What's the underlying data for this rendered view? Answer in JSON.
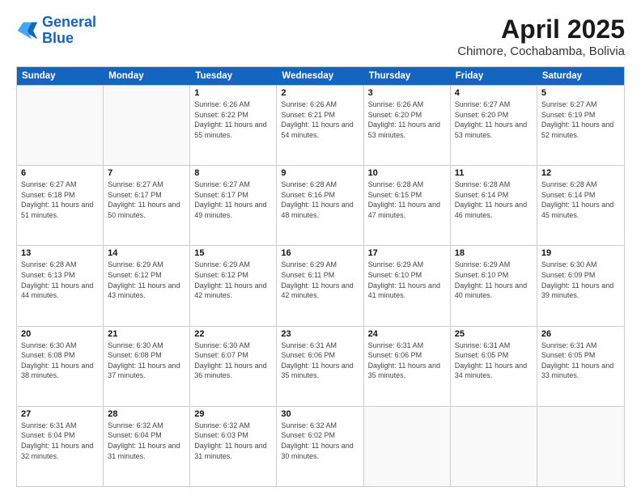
{
  "header": {
    "logo_line1": "General",
    "logo_line2": "Blue",
    "month_year": "April 2025",
    "location": "Chimore, Cochabamba, Bolivia"
  },
  "days_of_week": [
    "Sunday",
    "Monday",
    "Tuesday",
    "Wednesday",
    "Thursday",
    "Friday",
    "Saturday"
  ],
  "weeks": [
    [
      {
        "day": "",
        "info": ""
      },
      {
        "day": "",
        "info": ""
      },
      {
        "day": "1",
        "info": "Sunrise: 6:26 AM\nSunset: 6:22 PM\nDaylight: 11 hours and 55 minutes."
      },
      {
        "day": "2",
        "info": "Sunrise: 6:26 AM\nSunset: 6:21 PM\nDaylight: 11 hours and 54 minutes."
      },
      {
        "day": "3",
        "info": "Sunrise: 6:26 AM\nSunset: 6:20 PM\nDaylight: 11 hours and 53 minutes."
      },
      {
        "day": "4",
        "info": "Sunrise: 6:27 AM\nSunset: 6:20 PM\nDaylight: 11 hours and 53 minutes."
      },
      {
        "day": "5",
        "info": "Sunrise: 6:27 AM\nSunset: 6:19 PM\nDaylight: 11 hours and 52 minutes."
      }
    ],
    [
      {
        "day": "6",
        "info": "Sunrise: 6:27 AM\nSunset: 6:18 PM\nDaylight: 11 hours and 51 minutes."
      },
      {
        "day": "7",
        "info": "Sunrise: 6:27 AM\nSunset: 6:17 PM\nDaylight: 11 hours and 50 minutes."
      },
      {
        "day": "8",
        "info": "Sunrise: 6:27 AM\nSunset: 6:17 PM\nDaylight: 11 hours and 49 minutes."
      },
      {
        "day": "9",
        "info": "Sunrise: 6:28 AM\nSunset: 6:16 PM\nDaylight: 11 hours and 48 minutes."
      },
      {
        "day": "10",
        "info": "Sunrise: 6:28 AM\nSunset: 6:15 PM\nDaylight: 11 hours and 47 minutes."
      },
      {
        "day": "11",
        "info": "Sunrise: 6:28 AM\nSunset: 6:14 PM\nDaylight: 11 hours and 46 minutes."
      },
      {
        "day": "12",
        "info": "Sunrise: 6:28 AM\nSunset: 6:14 PM\nDaylight: 11 hours and 45 minutes."
      }
    ],
    [
      {
        "day": "13",
        "info": "Sunrise: 6:28 AM\nSunset: 6:13 PM\nDaylight: 11 hours and 44 minutes."
      },
      {
        "day": "14",
        "info": "Sunrise: 6:29 AM\nSunset: 6:12 PM\nDaylight: 11 hours and 43 minutes."
      },
      {
        "day": "15",
        "info": "Sunrise: 6:29 AM\nSunset: 6:12 PM\nDaylight: 11 hours and 42 minutes."
      },
      {
        "day": "16",
        "info": "Sunrise: 6:29 AM\nSunset: 6:11 PM\nDaylight: 11 hours and 42 minutes."
      },
      {
        "day": "17",
        "info": "Sunrise: 6:29 AM\nSunset: 6:10 PM\nDaylight: 11 hours and 41 minutes."
      },
      {
        "day": "18",
        "info": "Sunrise: 6:29 AM\nSunset: 6:10 PM\nDaylight: 11 hours and 40 minutes."
      },
      {
        "day": "19",
        "info": "Sunrise: 6:30 AM\nSunset: 6:09 PM\nDaylight: 11 hours and 39 minutes."
      }
    ],
    [
      {
        "day": "20",
        "info": "Sunrise: 6:30 AM\nSunset: 6:08 PM\nDaylight: 11 hours and 38 minutes."
      },
      {
        "day": "21",
        "info": "Sunrise: 6:30 AM\nSunset: 6:08 PM\nDaylight: 11 hours and 37 minutes."
      },
      {
        "day": "22",
        "info": "Sunrise: 6:30 AM\nSunset: 6:07 PM\nDaylight: 11 hours and 36 minutes."
      },
      {
        "day": "23",
        "info": "Sunrise: 6:31 AM\nSunset: 6:06 PM\nDaylight: 11 hours and 35 minutes."
      },
      {
        "day": "24",
        "info": "Sunrise: 6:31 AM\nSunset: 6:06 PM\nDaylight: 11 hours and 35 minutes."
      },
      {
        "day": "25",
        "info": "Sunrise: 6:31 AM\nSunset: 6:05 PM\nDaylight: 11 hours and 34 minutes."
      },
      {
        "day": "26",
        "info": "Sunrise: 6:31 AM\nSunset: 6:05 PM\nDaylight: 11 hours and 33 minutes."
      }
    ],
    [
      {
        "day": "27",
        "info": "Sunrise: 6:31 AM\nSunset: 6:04 PM\nDaylight: 11 hours and 32 minutes."
      },
      {
        "day": "28",
        "info": "Sunrise: 6:32 AM\nSunset: 6:04 PM\nDaylight: 11 hours and 31 minutes."
      },
      {
        "day": "29",
        "info": "Sunrise: 6:32 AM\nSunset: 6:03 PM\nDaylight: 11 hours and 31 minutes."
      },
      {
        "day": "30",
        "info": "Sunrise: 6:32 AM\nSunset: 6:02 PM\nDaylight: 11 hours and 30 minutes."
      },
      {
        "day": "",
        "info": ""
      },
      {
        "day": "",
        "info": ""
      },
      {
        "day": "",
        "info": ""
      }
    ]
  ]
}
